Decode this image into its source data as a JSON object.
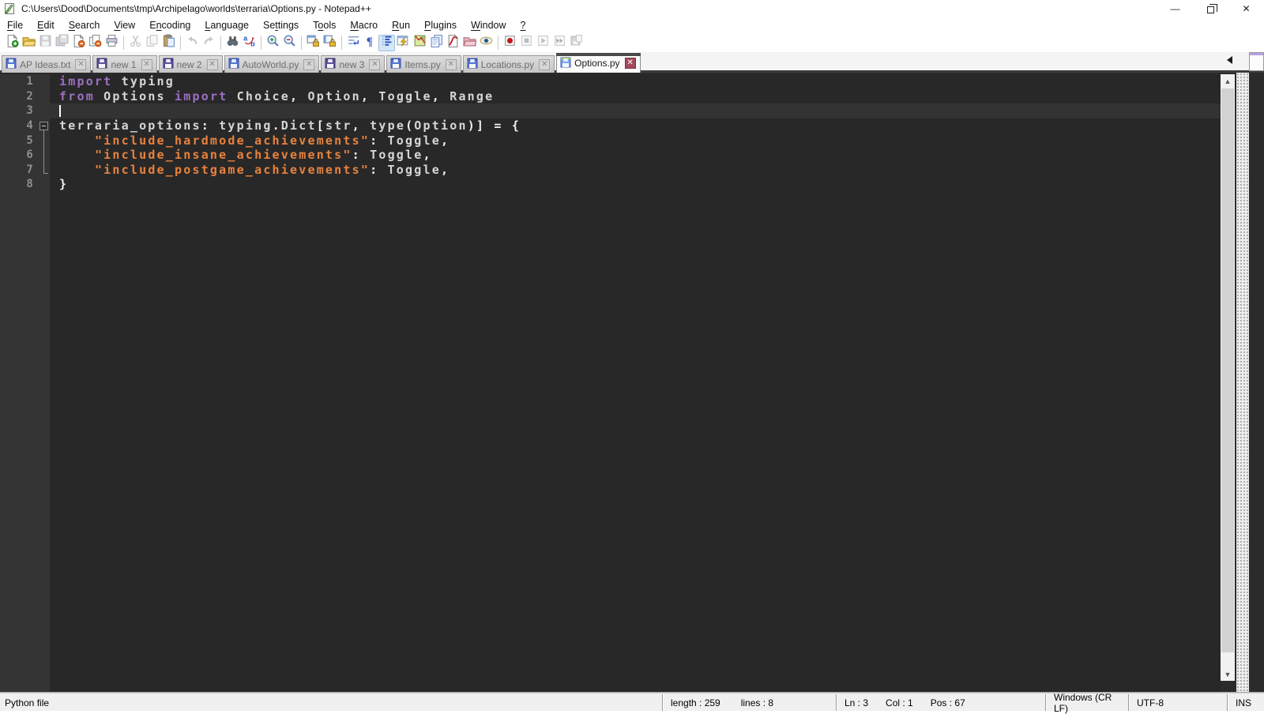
{
  "window": {
    "title": "C:\\Users\\Dood\\Documents\\tmp\\Archipelago\\worlds\\terraria\\Options.py - Notepad++",
    "minimize": "—",
    "close": "✕"
  },
  "menu": {
    "items": [
      {
        "label": "File",
        "m": 0
      },
      {
        "label": "Edit",
        "m": 0
      },
      {
        "label": "Search",
        "m": 0
      },
      {
        "label": "View",
        "m": 0
      },
      {
        "label": "Encoding",
        "m": 1
      },
      {
        "label": "Language",
        "m": 0
      },
      {
        "label": "Settings",
        "m": 2
      },
      {
        "label": "Tools",
        "m": 1
      },
      {
        "label": "Macro",
        "m": 0
      },
      {
        "label": "Run",
        "m": 0
      },
      {
        "label": "Plugins",
        "m": 0
      },
      {
        "label": "Window",
        "m": 0
      },
      {
        "label": "?",
        "m": 0
      }
    ]
  },
  "toolbar": {
    "items": [
      {
        "icon": "new-file"
      },
      {
        "icon": "open-file"
      },
      {
        "icon": "save-file",
        "disabled": true
      },
      {
        "icon": "save-all",
        "disabled": true
      },
      {
        "icon": "close-file"
      },
      {
        "icon": "close-all"
      },
      {
        "icon": "print"
      },
      {
        "sep": true
      },
      {
        "icon": "cut",
        "disabled": true
      },
      {
        "icon": "copy",
        "disabled": true
      },
      {
        "icon": "paste"
      },
      {
        "sep": true
      },
      {
        "icon": "undo",
        "disabled": true
      },
      {
        "icon": "redo",
        "disabled": true
      },
      {
        "sep": true
      },
      {
        "icon": "find"
      },
      {
        "icon": "replace"
      },
      {
        "sep": true
      },
      {
        "icon": "zoom-in"
      },
      {
        "icon": "zoom-out"
      },
      {
        "sep": true
      },
      {
        "icon": "sync-vertical"
      },
      {
        "icon": "sync-horizontal"
      },
      {
        "sep": true
      },
      {
        "icon": "word-wrap"
      },
      {
        "icon": "show-all-characters"
      },
      {
        "icon": "show-indent-guide",
        "active": true
      },
      {
        "icon": "udl-dialog"
      },
      {
        "icon": "document-map"
      },
      {
        "icon": "document-list"
      },
      {
        "icon": "function-list"
      },
      {
        "icon": "folder-as-workspace"
      },
      {
        "icon": "monitoring"
      },
      {
        "sep": true
      },
      {
        "icon": "macro-record"
      },
      {
        "icon": "macro-stop",
        "disabled": true
      },
      {
        "icon": "macro-play",
        "disabled": true
      },
      {
        "icon": "macro-run-multiple",
        "disabled": true
      },
      {
        "icon": "macro-save",
        "disabled": true
      }
    ]
  },
  "tabs": {
    "items": [
      {
        "label": "AP Ideas.txt",
        "state": "saved",
        "active": false
      },
      {
        "label": "new 1",
        "state": "modified",
        "active": false
      },
      {
        "label": "new 2",
        "state": "modified",
        "active": false
      },
      {
        "label": "AutoWorld.py",
        "state": "saved",
        "active": false
      },
      {
        "label": "new 3",
        "state": "modified",
        "active": false
      },
      {
        "label": "Items.py",
        "state": "saved",
        "active": false
      },
      {
        "label": "Locations.py",
        "state": "saved",
        "active": false
      },
      {
        "label": "Options.py",
        "state": "saved",
        "active": true
      }
    ],
    "close_glyph": "✕"
  },
  "editor": {
    "current_line": 3,
    "caret": {
      "line": 3,
      "col": 1
    },
    "fold": {
      "box_line": 4,
      "line_to": 7
    },
    "lines": [
      {
        "n": 1,
        "seg": [
          [
            "k",
            "import"
          ],
          [
            "d",
            " typing"
          ]
        ]
      },
      {
        "n": 2,
        "seg": [
          [
            "k",
            "from"
          ],
          [
            "d",
            " Options "
          ],
          [
            "k",
            "import"
          ],
          [
            "d",
            " Choice"
          ],
          [
            "o",
            ","
          ],
          [
            "d",
            " Option"
          ],
          [
            "o",
            ","
          ],
          [
            "d",
            " Toggle"
          ],
          [
            "o",
            ","
          ],
          [
            "d",
            " Range"
          ]
        ]
      },
      {
        "n": 3,
        "seg": []
      },
      {
        "n": 4,
        "seg": [
          [
            "d",
            "terraria_options"
          ],
          [
            "o",
            ":"
          ],
          [
            "d",
            " typing"
          ],
          [
            "o",
            "."
          ],
          [
            "d",
            "Dict"
          ],
          [
            "o",
            "["
          ],
          [
            "d",
            "str"
          ],
          [
            "o",
            ","
          ],
          [
            "d",
            " type"
          ],
          [
            "o",
            "("
          ],
          [
            "d",
            "Option"
          ],
          [
            "o",
            ")"
          ],
          [
            "o",
            "]"
          ],
          [
            "d",
            " "
          ],
          [
            "o",
            "="
          ],
          [
            "d",
            " "
          ],
          [
            "o",
            "{"
          ]
        ]
      },
      {
        "n": 5,
        "seg": [
          [
            "d",
            "    "
          ],
          [
            "s",
            "\"include_hardmode_achievements\""
          ],
          [
            "o",
            ":"
          ],
          [
            "d",
            " Toggle"
          ],
          [
            "o",
            ","
          ]
        ]
      },
      {
        "n": 6,
        "seg": [
          [
            "d",
            "    "
          ],
          [
            "s",
            "\"include_insane_achievements\""
          ],
          [
            "o",
            ":"
          ],
          [
            "d",
            " Toggle"
          ],
          [
            "o",
            ","
          ]
        ]
      },
      {
        "n": 7,
        "seg": [
          [
            "d",
            "    "
          ],
          [
            "s",
            "\"include_postgame_achievements\""
          ],
          [
            "o",
            ":"
          ],
          [
            "d",
            " Toggle"
          ],
          [
            "o",
            ","
          ]
        ]
      },
      {
        "n": 8,
        "seg": [
          [
            "o",
            "}"
          ]
        ]
      }
    ]
  },
  "colors": {
    "keyword": "#9d6fc3",
    "string": "#e8823d",
    "default_text": "#d6d6d6",
    "editor_bg": "#282828",
    "gutter_bg": "#343434",
    "active_tab_close": "#a34a5c"
  },
  "status_bar": {
    "doc_type": "Python file",
    "length_text": "length : 259",
    "lines_text": "lines : 8",
    "ln_text": "Ln : 3",
    "col_text": "Col : 1",
    "pos_text": "Pos : 67",
    "eol": "Windows (CR LF)",
    "encoding": "UTF-8",
    "ins_mode": "INS"
  }
}
